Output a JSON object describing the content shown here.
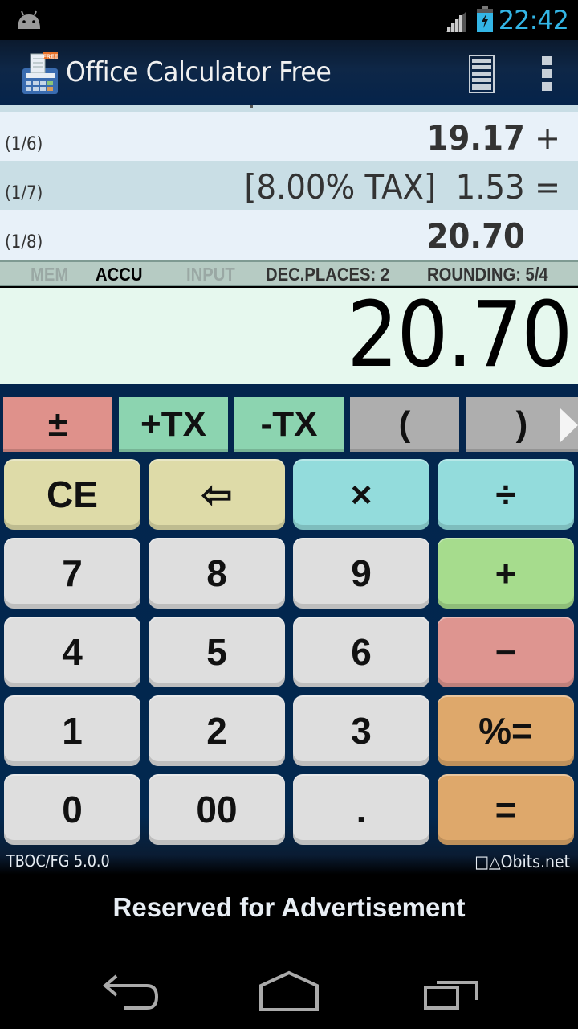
{
  "status_bar": {
    "time": "22:42",
    "icons": [
      "android-debug-icon",
      "signal-icon",
      "battery-charging-icon"
    ]
  },
  "action_bar": {
    "title": "Office Calculator Free",
    "app_icon": "calculator-app-icon",
    "app_icon_badge": "FREE",
    "actions": [
      "tape-list-icon",
      "overflow-menu-icon"
    ]
  },
  "tape": {
    "rows": [
      {
        "index": "(1/6)",
        "value": "19.17",
        "operator": "+",
        "bold": true
      },
      {
        "index": "(1/7)",
        "value": "[8.00% TAX]  1.53",
        "operator": "=",
        "bold": false
      },
      {
        "index": "(1/8)",
        "value": "20.70",
        "operator": "",
        "bold": true
      }
    ]
  },
  "status_strip": {
    "mem": "MEM",
    "accu": "ACCU",
    "input": "INPUT",
    "dec_places": "DEC.PLACES: 2",
    "rounding": "ROUNDING: 5/4"
  },
  "display": {
    "value": "20.70"
  },
  "function_row": {
    "keys": [
      "±",
      "+TX",
      "-TX",
      "(",
      ")"
    ],
    "scroll_icon": "chevron-right-icon"
  },
  "keypad": {
    "rows": [
      [
        "CE",
        "⇦",
        "×",
        "÷"
      ],
      [
        "7",
        "8",
        "9",
        "+"
      ],
      [
        "4",
        "5",
        "6",
        "−"
      ],
      [
        "1",
        "2",
        "3",
        "%="
      ],
      [
        "0",
        "00",
        ".",
        "="
      ]
    ]
  },
  "footer": {
    "version": "TBOC/FG 5.0.0",
    "brand": "□△Obits.net"
  },
  "ad": {
    "text": "Reserved for Advertisement"
  },
  "nav_bar": {
    "buttons": [
      "back-icon",
      "home-icon",
      "recent-apps-icon"
    ]
  },
  "colors": {
    "clock": "#33b5e5",
    "keypad_bg": "#03254d",
    "display_bg": "#e6f8ee",
    "key_gray": "#dedede",
    "key_yellow": "#dedba8",
    "key_cyan": "#93dcdc",
    "key_green": "#a6dc8d",
    "key_red": "#de9590",
    "key_orange": "#dea86b",
    "fkey_teal": "#8cd4b0",
    "fkey_gray": "#aeaeae"
  }
}
